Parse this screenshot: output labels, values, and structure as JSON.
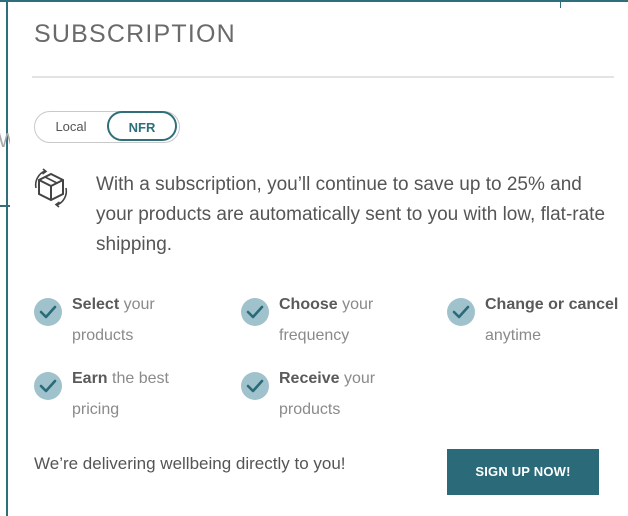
{
  "panel": {
    "title": "SUBSCRIPTION",
    "toggle": {
      "options": [
        "Local",
        "NFR"
      ],
      "selected": "NFR"
    },
    "info": {
      "icon": "recycle-box-icon",
      "text": "With a subscription, you’ll continue to save up to 25% and your products are automatically sent to you with low, flat-rate shipping."
    },
    "benefits": [
      {
        "bold": "Select",
        "rest": " your products",
        "icon": "check-circle-icon"
      },
      {
        "bold": "Choose",
        "rest": " your frequency",
        "icon": "check-circle-icon"
      },
      {
        "bold": "Change or cancel",
        "rest": " anytime",
        "icon": "check-circle-icon"
      },
      {
        "bold": "Earn",
        "rest": " the best pricing",
        "icon": "check-circle-icon"
      },
      {
        "bold": "Receive",
        "rest": " your products",
        "icon": "check-circle-icon"
      }
    ],
    "tagline": "We’re delivering wellbeing directly to you!",
    "cta": "SIGN UP NOW!"
  },
  "background": {
    "partial_letter": "W"
  },
  "colors": {
    "accent": "#2b6a78",
    "check_bg": "#9fc2cc",
    "text": "#555555",
    "muted_text": "#8a8a8a",
    "divider": "#e3e3e3"
  }
}
